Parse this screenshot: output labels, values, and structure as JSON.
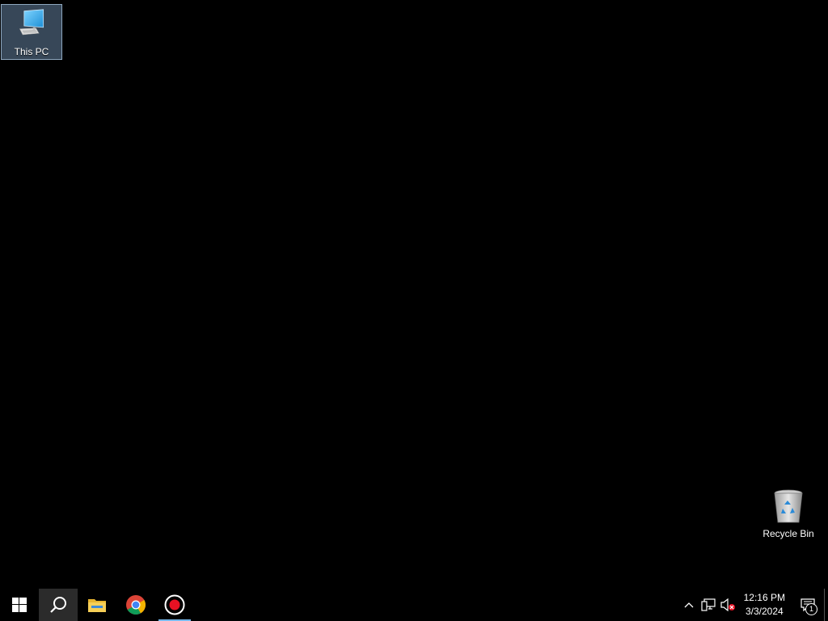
{
  "desktop": {
    "icons": [
      {
        "label": "This PC",
        "icon": "this-pc-icon",
        "selected": true
      },
      {
        "label": "Recycle Bin",
        "icon": "recycle-bin-icon",
        "selected": false
      }
    ]
  },
  "taskbar": {
    "start_icon": "windows-logo-icon",
    "search_icon": "search-icon",
    "pinned": [
      {
        "name": "File Explorer",
        "icon": "folder-icon"
      },
      {
        "name": "Google Chrome",
        "icon": "chrome-icon"
      },
      {
        "name": "Screen Recorder",
        "icon": "record-icon",
        "running": true
      }
    ],
    "tray": {
      "icons": [
        "chevron-up-icon",
        "network-icon",
        "volume-muted-icon"
      ],
      "time": "12:16 PM",
      "date": "3/3/2024",
      "notification_count": "1"
    }
  },
  "colors": {
    "background": "#000000",
    "taskbar": "#000000",
    "accent": "#76b9ed",
    "record": "#e81123"
  }
}
